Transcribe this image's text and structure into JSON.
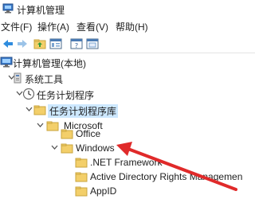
{
  "window": {
    "title": "计算机管理",
    "app_icon": "computer-management-icon"
  },
  "menu": {
    "items": [
      {
        "label": "文件(F)"
      },
      {
        "label": "操作(A)"
      },
      {
        "label": "查看(V)"
      },
      {
        "label": "帮助(H)"
      }
    ]
  },
  "toolbar": {
    "buttons": [
      {
        "icon": "back-arrow-icon"
      },
      {
        "icon": "forward-arrow-icon"
      },
      {
        "icon": "up-folder-icon"
      },
      {
        "icon": "show-hide-tree-icon"
      },
      {
        "icon": "help-icon"
      },
      {
        "icon": "properties-icon"
      }
    ]
  },
  "tree": {
    "nodes": [
      {
        "label": "计算机管理(本地)",
        "icon": "computer-management-icon"
      },
      {
        "label": "系统工具",
        "icon": "tools-icon"
      },
      {
        "label": "任务计划程序",
        "icon": "clock-icon"
      },
      {
        "label": "任务计划程序库",
        "icon": "folder-icon"
      },
      {
        "label": "Microsoft",
        "icon": "folder-icon"
      },
      {
        "label": "Office",
        "icon": "folder-icon"
      },
      {
        "label": "Windows",
        "icon": "folder-icon"
      },
      {
        "label": ".NET Framework",
        "icon": "folder-icon"
      },
      {
        "label": "Active Directory Rights Managemen",
        "icon": "folder-icon"
      },
      {
        "label": "AppID",
        "icon": "folder-icon"
      }
    ]
  },
  "colors": {
    "annotation_arrow": "#e02a2a",
    "folder": "#f3cf6a",
    "selection": "#cde8ff"
  }
}
